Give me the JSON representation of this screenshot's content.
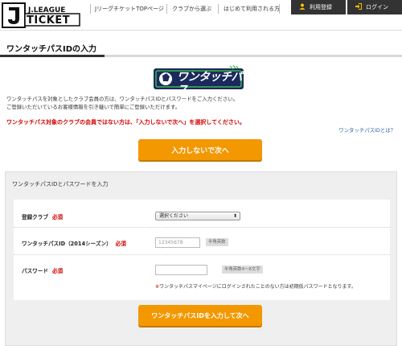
{
  "header": {
    "logo_line1": "J.LEAGUE",
    "logo_line2": "TICKET",
    "nav": [
      "JリーグチケットTOPページ",
      "クラブから選ぶ",
      "はじめて利用される方"
    ],
    "register_label": "利用登録",
    "login_label": "ログイン"
  },
  "page": {
    "title": "ワンタッチパスIDの入力",
    "otp_logo_text": "ワンタッチパス",
    "intro_line1": "ワンタッチパスを対象としたクラブ会員の方は、ワンタッチパスIDとパスワードをご入力ください。",
    "intro_line2": "ご登録いただいているお客様情報を引き継いで簡単にご登録いただけます。",
    "warning": "ワンタッチパス対象のクラブの会員ではない方は、「入力しないで次へ」を選択してください。",
    "what_link": "ワンタッチパスIDとは？",
    "skip_button": "入力しないで次へ"
  },
  "form": {
    "panel_title": "ワンタッチパスIDとパスワードを入力",
    "required_label": "必須",
    "club_label": "登録クラブ",
    "club_select_value": "選択ください",
    "id_label": "ワンタッチパスID（2014シーズン）",
    "id_placeholder": "12345678",
    "id_hint": "半角英数",
    "password_label": "パスワード",
    "password_hint": "半角英数4～8文字",
    "password_note_mark": "※",
    "password_note": "ワンタッチパスマイページにログインされたことのない方は初期仮パスワードとなります。",
    "submit_button": "ワンタッチパスIDを入力して次へ"
  },
  "colors": {
    "accent_orange": "#f39800",
    "required_red": "#d40000",
    "link_blue": "#2b5ea8",
    "otp_navy": "#1b2a5c",
    "otp_green": "#3ab84a"
  }
}
